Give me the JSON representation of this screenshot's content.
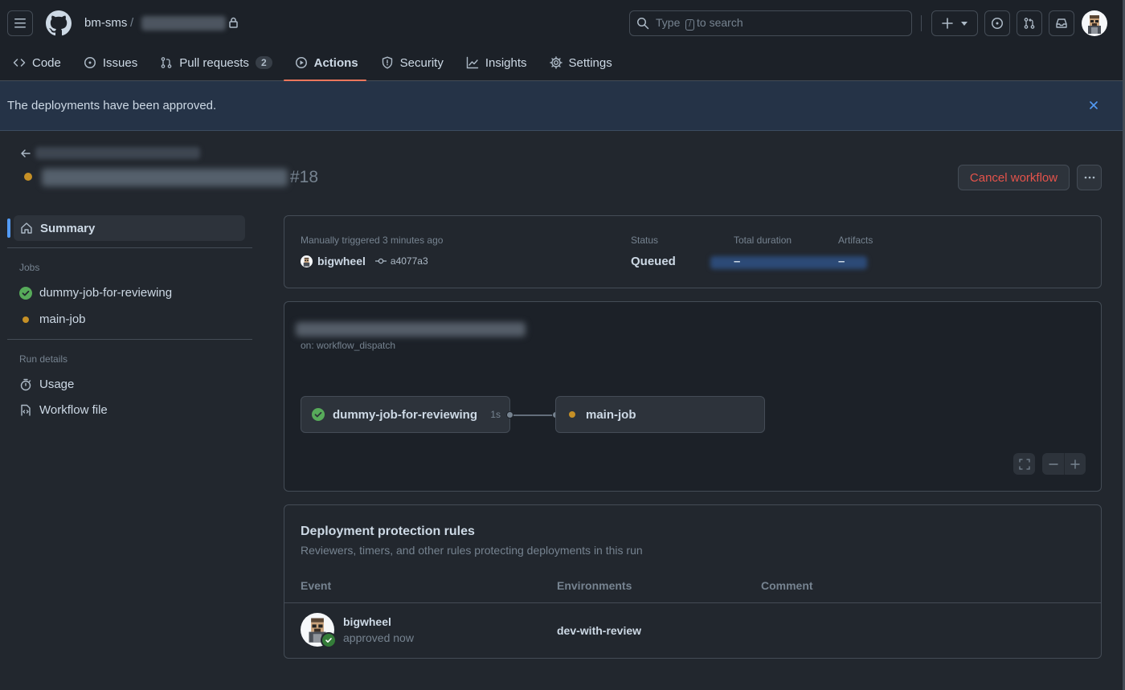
{
  "header": {
    "owner": "bm-sms",
    "separator": "/",
    "search": {
      "prefix": "Type",
      "key": "/",
      "suffix": "to search"
    }
  },
  "nav": {
    "code": "Code",
    "issues": "Issues",
    "pull_requests": "Pull requests",
    "pull_requests_count": "2",
    "actions": "Actions",
    "security": "Security",
    "insights": "Insights",
    "settings": "Settings"
  },
  "flash": {
    "message": "The deployments have been approved."
  },
  "run": {
    "number": "#18",
    "status_color": "#c69026",
    "cancel_label": "Cancel workflow"
  },
  "sidebar": {
    "summary": "Summary",
    "jobs_heading": "Jobs",
    "jobs": [
      {
        "label": "dummy-job-for-reviewing",
        "status": "success"
      },
      {
        "label": "main-job",
        "status": "queued"
      }
    ],
    "run_details_heading": "Run details",
    "usage": "Usage",
    "workflow_file": "Workflow file"
  },
  "summary_card": {
    "trigger": "Manually triggered 3 minutes ago",
    "actor": "bigwheel",
    "commit": "a4077a3",
    "status_label": "Status",
    "status_value": "Queued",
    "duration_label": "Total duration",
    "duration_value": "–",
    "artifacts_label": "Artifacts",
    "artifacts_value": "–"
  },
  "graph": {
    "trigger": "on: workflow_dispatch",
    "job1": {
      "label": "dummy-job-for-reviewing",
      "duration": "1s"
    },
    "job2": {
      "label": "main-job"
    }
  },
  "deployment": {
    "title": "Deployment protection rules",
    "subtitle": "Reviewers, timers, and other rules protecting deployments in this run",
    "col_event": "Event",
    "col_env": "Environments",
    "col_comment": "Comment",
    "row": {
      "user": "bigwheel",
      "time": "approved now",
      "environment": "dev-with-review"
    }
  },
  "colors": {
    "accent": "#539bf5",
    "success": "#57ab5a",
    "pending": "#c69026",
    "danger": "#e5534b"
  }
}
